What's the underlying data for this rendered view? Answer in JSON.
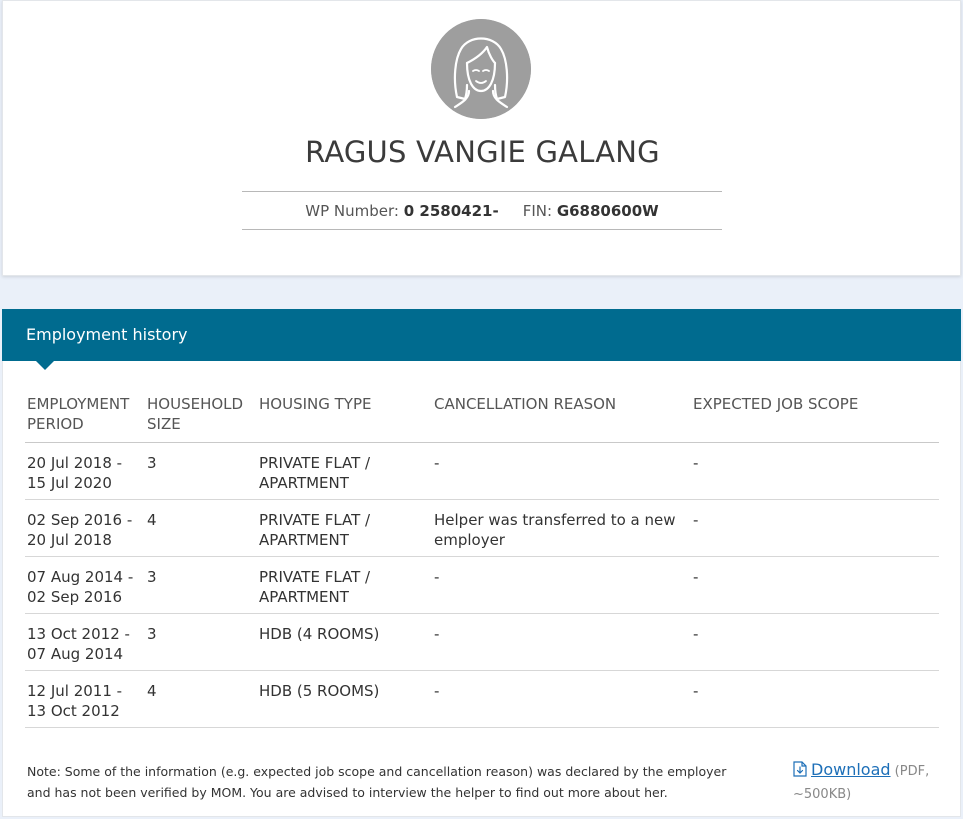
{
  "profile": {
    "name": "RAGUS VANGIE GALANG",
    "wp_label": "WP Number:",
    "wp_value": "0 2580421-",
    "fin_label": "FIN:",
    "fin_value": "G6880600W",
    "avatar_icon": "female-avatar-icon"
  },
  "history": {
    "title": "Employment history",
    "columns": [
      "EMPLOYMENT PERIOD",
      "HOUSEHOLD SIZE",
      "HOUSING TYPE",
      "CANCELLATION REASON",
      "EXPECTED JOB SCOPE"
    ],
    "rows": [
      {
        "period": "20 Jul 2018 - 15 Jul 2020",
        "size": "3",
        "housing": "PRIVATE FLAT / APARTMENT",
        "reason": "-",
        "scope": "-"
      },
      {
        "period": "02 Sep 2016 - 20 Jul 2018",
        "size": "4",
        "housing": "PRIVATE FLAT / APARTMENT",
        "reason": "Helper was transferred to a new employer",
        "scope": "-"
      },
      {
        "period": "07 Aug 2014 - 02 Sep 2016",
        "size": "3",
        "housing": "PRIVATE FLAT / APARTMENT",
        "reason": "-",
        "scope": "-"
      },
      {
        "period": "13 Oct 2012 - 07 Aug 2014",
        "size": "3",
        "housing": "HDB (4 ROOMS)",
        "reason": "-",
        "scope": "-"
      },
      {
        "period": "12 Jul 2011 - 13 Oct 2012",
        "size": "4",
        "housing": "HDB (5 ROOMS)",
        "reason": "-",
        "scope": "-"
      }
    ],
    "note": "Note: Some of the information (e.g. expected job scope and cancellation reason) was declared by the employer and has not been verified by MOM. You are advised to interview the helper to find out more about her.",
    "download_label": "Download",
    "download_meta": "(PDF, ~500KB)",
    "download_icon": "pdf-download-icon"
  },
  "colors": {
    "header_bg": "#006b8f",
    "page_bg": "#eaf0f9",
    "link": "#1d6fb8"
  }
}
